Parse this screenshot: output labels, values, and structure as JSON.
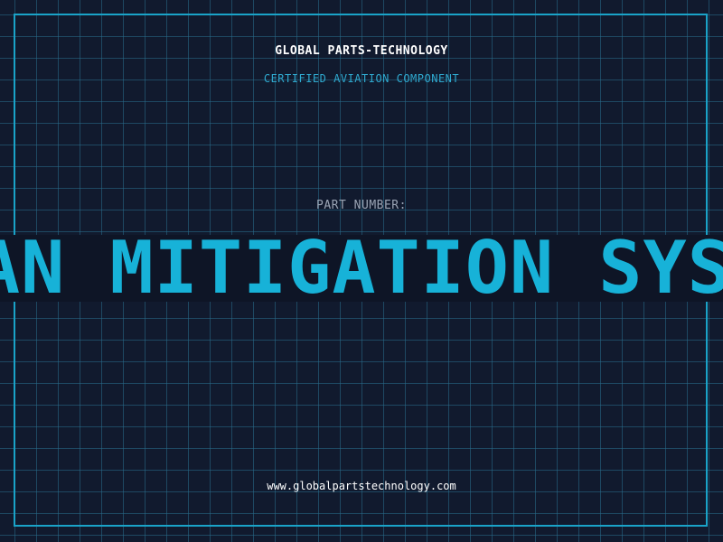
{
  "brand": {
    "name": "GLOBAL PARTS-TECHNOLOGY",
    "tagline": "CERTIFIED AVIATION COMPONENT"
  },
  "part": {
    "label": "PART NUMBER:",
    "value": "AN MITIGATION SYST"
  },
  "footer": {
    "website": "www.globalpartstechnology.com"
  },
  "colors": {
    "background": "#111a2e",
    "grid": "#286e8c",
    "accent": "#17b2d8",
    "frame": "#1aa3c8",
    "label": "#9aa4b4",
    "text": "#ffffff"
  }
}
